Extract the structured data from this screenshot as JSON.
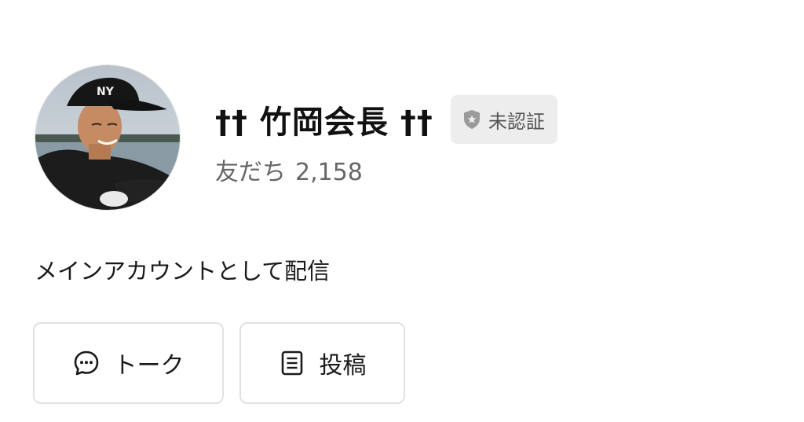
{
  "profile": {
    "name": "†† 竹岡会長 ††",
    "verification_badge": {
      "label": "未認証",
      "icon": "shield-icon",
      "background": "#ededed"
    },
    "friends": {
      "label": "友だち",
      "count": "2,158"
    },
    "avatar": "avatar-photo"
  },
  "status_message": "メインアカウントとして配信",
  "actions": [
    {
      "label": "トーク",
      "icon": "chat-bubble-icon"
    },
    {
      "label": "投稿",
      "icon": "document-icon"
    }
  ]
}
